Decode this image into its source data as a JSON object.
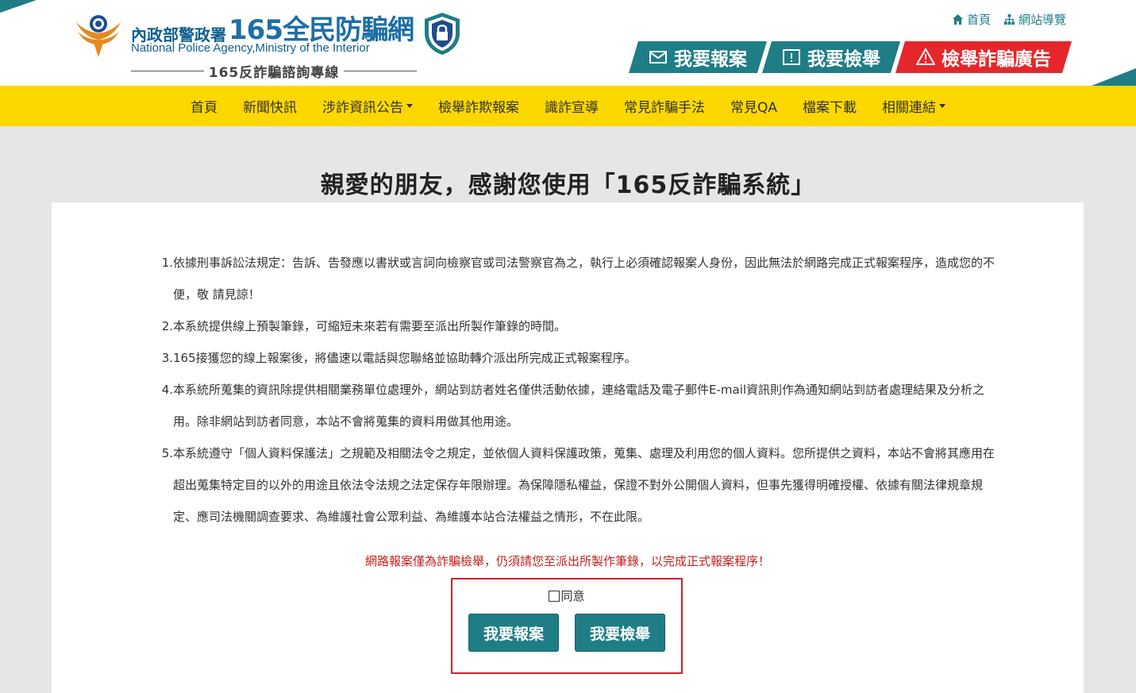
{
  "header": {
    "agency_zh": "內政部警政署",
    "brand": "165全民防騙網",
    "agency_en": "National Police Agency,Ministry of the Interior",
    "hotline": "165反詐騙諮詢專線",
    "top_links": [
      {
        "label": "首頁",
        "icon": "home-icon"
      },
      {
        "label": "網站導覽",
        "icon": "sitemap-icon"
      }
    ],
    "actions": {
      "report": "我要報案",
      "tip": "我要檢舉",
      "ad": "檢舉詐騙廣告"
    }
  },
  "nav": {
    "items": [
      {
        "label": "首頁",
        "dropdown": false
      },
      {
        "label": "新聞快訊",
        "dropdown": false
      },
      {
        "label": "涉詐資訊公告",
        "dropdown": true
      },
      {
        "label": "檢舉詐欺報案",
        "dropdown": false
      },
      {
        "label": "識詐宣導",
        "dropdown": false
      },
      {
        "label": "常見詐騙手法",
        "dropdown": false
      },
      {
        "label": "常見QA",
        "dropdown": false
      },
      {
        "label": "檔案下載",
        "dropdown": false
      },
      {
        "label": "相關連結",
        "dropdown": true
      }
    ]
  },
  "main": {
    "title": "親愛的朋友，感謝您使用「165反詐騙系統」",
    "terms": [
      {
        "num": "1.",
        "text": "依據刑事訴訟法規定：告訴、告發應以書狀或言詞向檢察官或司法警察官為之，執行上必須確認報案人身份，因此無法於網路完成正式報案程序，造成您的不便，敬 請見諒！"
      },
      {
        "num": "2.",
        "text": "本系統提供線上預製筆錄，可縮短未來若有需要至派出所製作筆錄的時間。"
      },
      {
        "num": "3.",
        "text": "165接獲您的線上報案後，將儘速以電話與您聯絡並協助轉介派出所完成正式報案程序。"
      },
      {
        "num": "4.",
        "text": "本系統所蒐集的資訊除提供相關業務單位處理外，網站到訪者姓名僅供活動依據，連絡電話及電子郵件E-mail資訊則作為通知網站到訪者處理結果及分析之用。除非網站到訪者同意，本站不會將蒐集的資料用做其他用途。"
      },
      {
        "num": "5.",
        "text": "本系統遵守「個人資料保護法」之規範及相關法令之規定，並依個人資料保護政策，蒐集、處理及利用您的個人資料。您所提供之資料，本站不會將其應用在超出蒐集特定目的以外的用途且依法令法規之法定保存年限辦理。為保障隱私權益，保證不對外公開個人資料，但事先獲得明確授權、依據有關法律規章規定、應司法機關調查要求、為維護社會公眾利益、為維護本站合法權益之情形，不在此限。"
      }
    ],
    "warning": "網路報案僅為詐騙檢舉，仍須請您至派出所製作筆錄，以完成正式報案程序！",
    "agree_label": "同意",
    "agree_checked": false,
    "btn_report": "我要報案",
    "btn_tip": "我要檢舉"
  },
  "colors": {
    "teal": "#1f7d86",
    "yellow": "#fcd800",
    "red": "#e5262a",
    "warning_red": "#c0201d"
  }
}
